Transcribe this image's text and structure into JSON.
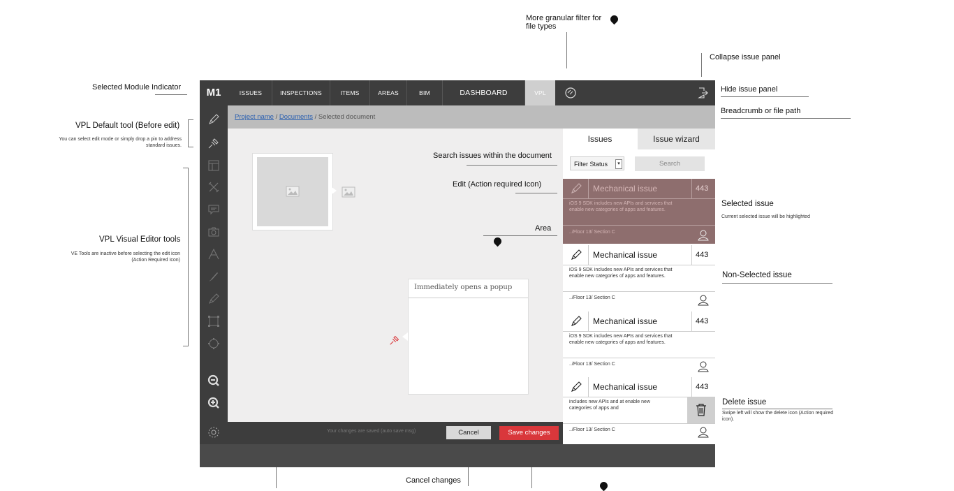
{
  "annotations": {
    "granular_filter": "More granular filter for\nfile types",
    "collapse_panel": "Collapse issue panel",
    "selected_module": "Selected Module Indicator",
    "hide_panel": "Hide issue panel",
    "breadcrumb": "Breadcrumb or file path",
    "vpl_default_tool": "VPL Default tool (Before edit)",
    "vpl_default_tool_desc": "You can select edit mode or simply drop a pin to address standard issues.",
    "vpl_visual_tools": "VPL Visual Editor tools",
    "vpl_visual_tools_desc": "VE Tools are inactive before selecting the edit icon (Action Required Icon)",
    "search_issues": "Search issues within the document",
    "edit_action": "Edit (Action required Icon)",
    "area": "Area",
    "selected_issue": "Selected issue",
    "selected_issue_desc": "Current selected issue will be highlighted",
    "non_selected_issue": "Non-Selected issue",
    "delete_issue": "Delete issue",
    "delete_issue_desc": "Swipe left will show the delete icon (Action required icon).",
    "cancel_changes": "Cancel changes"
  },
  "nav": {
    "module": "M1",
    "tabs": [
      {
        "label": "ISSUES"
      },
      {
        "label": "INSPECTIONS"
      },
      {
        "label": "ITEMS"
      },
      {
        "label": "AREAS"
      },
      {
        "label": "BIM"
      },
      {
        "label": "DASHBOARD"
      },
      {
        "label": "VPL"
      }
    ],
    "active_tab": "VPL"
  },
  "breadcrumb": {
    "project": "Project name",
    "sep1": "/",
    "documents": "Documents",
    "sep2": "/",
    "current": "Selected document"
  },
  "canvas": {
    "popup_title": "Immediately opens a popup"
  },
  "bottom_bar": {
    "autosave_msg": "Your changes are saved (auto save msg)",
    "cancel_label": "Cancel",
    "save_label": "Save changes"
  },
  "panel": {
    "tab_issues": "Issues",
    "tab_wizard": "Issue wizard",
    "filter_value": "Filter Status",
    "search_label": "Search",
    "issues": [
      {
        "title": "Mechanical issue",
        "count": "443",
        "desc": "iOS 9 SDK includes new APIs and services that enable new categories of apps and features.",
        "path": "../Floor 13/ Section C",
        "selected": true
      },
      {
        "title": "Mechanical issue",
        "count": "443",
        "desc": "iOS 9 SDK includes new APIs and services that enable new categories of apps and features.",
        "path": "../Floor 13/ Section C",
        "selected": false
      },
      {
        "title": "Mechanical issue",
        "count": "443",
        "desc": "iOS 9 SDK includes new APIs and services that enable new categories of apps and features.",
        "path": "../Floor 13/ Section C",
        "selected": false
      },
      {
        "title": "Mechanical issue",
        "count": "443",
        "desc": "includes new APIs and at enable new categories of apps and",
        "path": "../Floor 13/ Section C",
        "selected": false
      }
    ]
  },
  "colors": {
    "dark": "#3d3d3d",
    "selected_issue": "#8e6e6e",
    "save_red": "#d9373b",
    "link_blue": "#2a5fb0"
  }
}
